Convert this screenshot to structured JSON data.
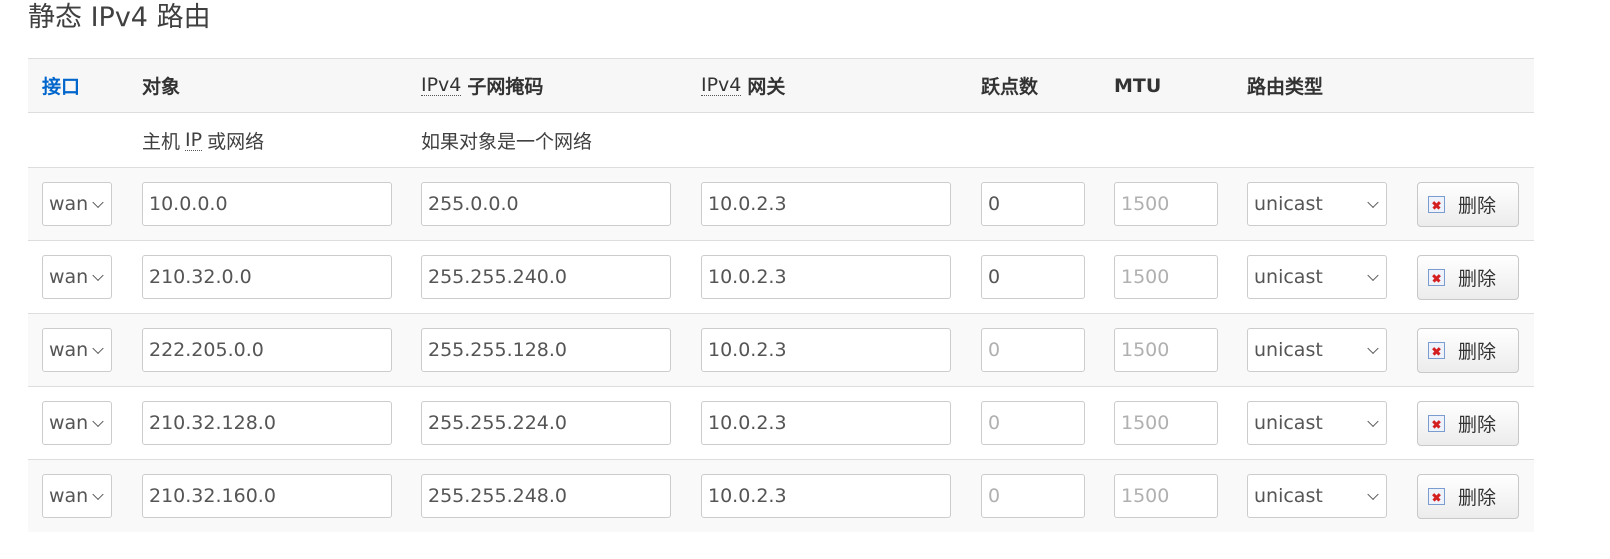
{
  "title": "静态 IPv4 路由",
  "headers": {
    "interface": "接口",
    "target": "对象",
    "netmask_abbr": "IPv4",
    "netmask": "子网掩码",
    "gateway_abbr": "IPv4",
    "gateway": "网关",
    "metric": "跃点数",
    "mtu": "MTU",
    "route_type": "路由类型"
  },
  "descriptions": {
    "target_prefix": "主机",
    "target_abbr": "IP",
    "target_suffix": "或网络",
    "netmask": "如果对象是一个网络"
  },
  "rows": [
    {
      "interface": "wan",
      "target": "10.0.0.0",
      "netmask": "255.0.0.0",
      "gateway": "10.0.2.3",
      "metric": "0",
      "metric_is_placeholder": false,
      "mtu": "1500",
      "type": "unicast",
      "delete_label": "删除"
    },
    {
      "interface": "wan",
      "target": "210.32.0.0",
      "netmask": "255.255.240.0",
      "gateway": "10.0.2.3",
      "metric": "0",
      "metric_is_placeholder": false,
      "mtu": "1500",
      "type": "unicast",
      "delete_label": "删除"
    },
    {
      "interface": "wan",
      "target": "222.205.0.0",
      "netmask": "255.255.128.0",
      "gateway": "10.0.2.3",
      "metric": "0",
      "metric_is_placeholder": true,
      "mtu": "1500",
      "type": "unicast",
      "delete_label": "删除"
    },
    {
      "interface": "wan",
      "target": "210.32.128.0",
      "netmask": "255.255.224.0",
      "gateway": "10.0.2.3",
      "metric": "0",
      "metric_is_placeholder": true,
      "mtu": "1500",
      "type": "unicast",
      "delete_label": "删除"
    },
    {
      "interface": "wan",
      "target": "210.32.160.0",
      "netmask": "255.255.248.0",
      "gateway": "10.0.2.3",
      "metric": "0",
      "metric_is_placeholder": true,
      "mtu": "1500",
      "type": "unicast",
      "delete_label": "删除"
    }
  ],
  "colors": {
    "link": "#0066cc",
    "header_bg": "#f7f7f7",
    "delete_icon_red": "#d42020"
  },
  "icons": {
    "delete": "delete-icon",
    "dropdown": "chevron-down-icon"
  }
}
